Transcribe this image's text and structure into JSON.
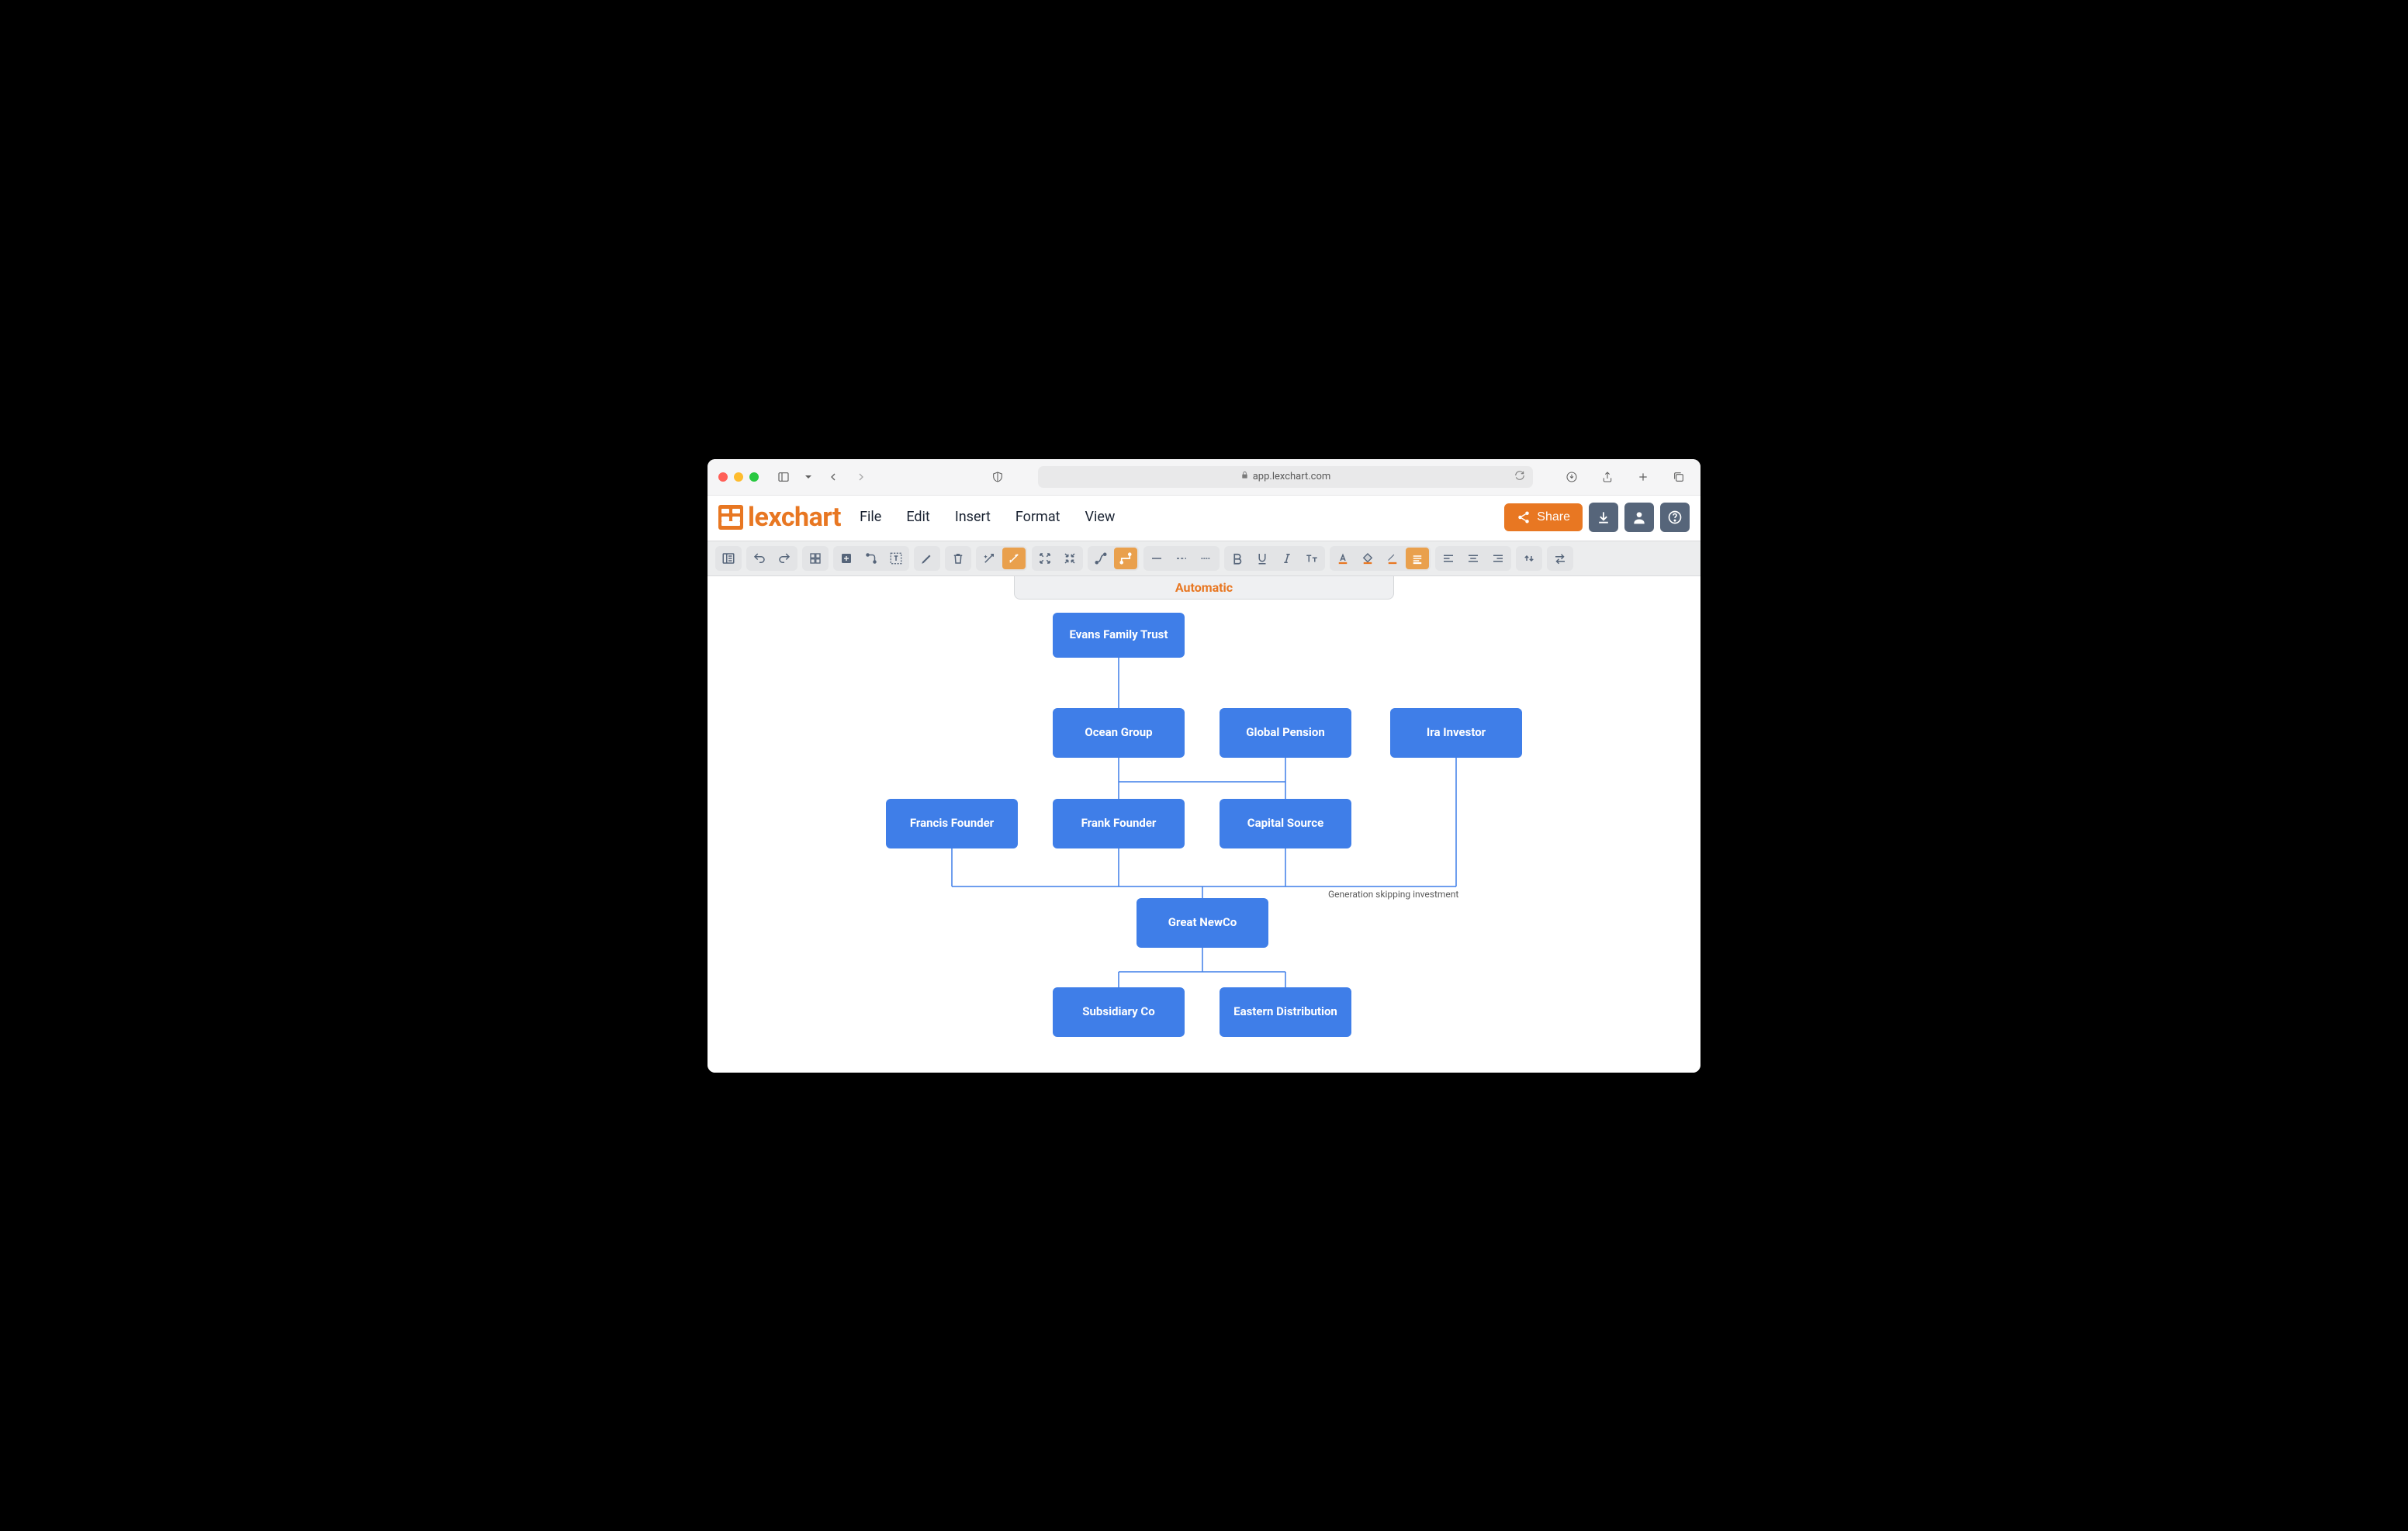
{
  "browser": {
    "url": "app.lexchart.com"
  },
  "app": {
    "name": "lexchart"
  },
  "menubar": {
    "items": [
      "File",
      "Edit",
      "Insert",
      "Format",
      "View"
    ]
  },
  "header_actions": {
    "share_label": "Share"
  },
  "layout_mode": "Automatic",
  "nodes": {
    "evans_family_trust": "Evans Family Trust",
    "ocean_group": "Ocean Group",
    "global_pension": "Global Pension",
    "ira_investor": "Ira Investor",
    "francis_founder": "Francis Founder",
    "frank_founder": "Frank Founder",
    "capital_source": "Capital Source",
    "great_newco": "Great NewCo",
    "subsidiary_co": "Subsidiary Co",
    "eastern_distribution": "Eastern Distribution"
  },
  "annotations": {
    "gen_skip": "Generation skipping investment"
  },
  "colors": {
    "brand": "#e87722",
    "node": "#3f7ee8",
    "toolbar_icon": "#56657a"
  }
}
